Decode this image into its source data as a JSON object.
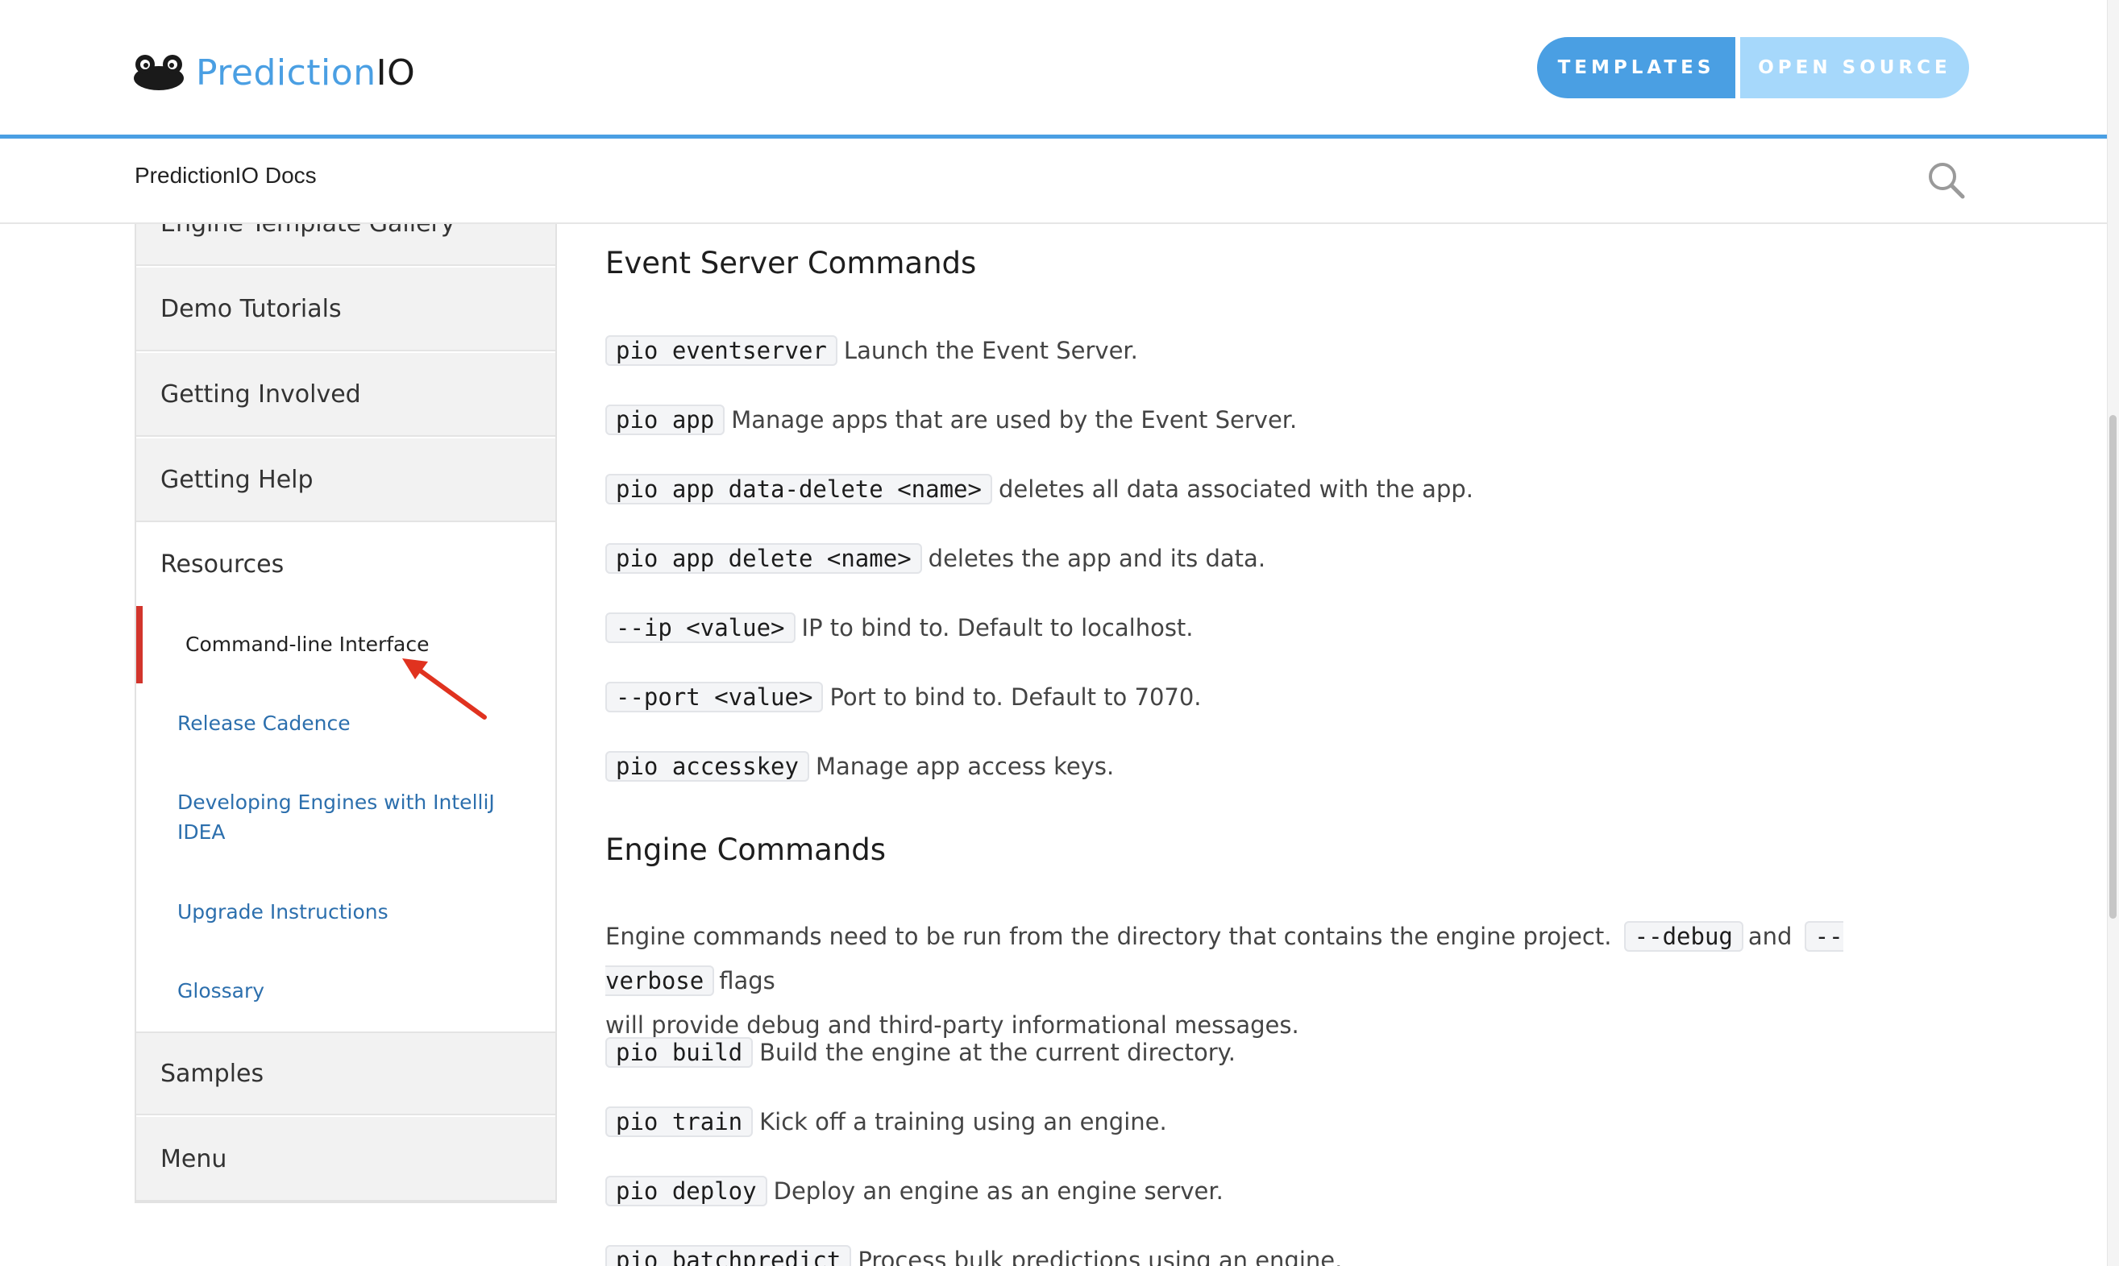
{
  "header": {
    "logo_text_part1": "Prediction",
    "logo_text_part2": "IO",
    "buttons": {
      "templates": "TEMPLATES",
      "open_source": "OPEN SOURCE"
    },
    "colors": {
      "accent": "#4a9fe3",
      "secondary": "#a6d8fb"
    }
  },
  "subheader": {
    "title": "PredictionIO Docs",
    "search_icon": "search-icon"
  },
  "sidebar": {
    "items_top": [
      {
        "label": "Engine Template Gallery"
      },
      {
        "label": "Demo Tutorials"
      },
      {
        "label": "Getting Involved"
      },
      {
        "label": "Getting Help"
      }
    ],
    "resources": {
      "label": "Resources",
      "children": [
        {
          "label": "Command-line Interface",
          "active": true
        },
        {
          "label": "Release Cadence"
        },
        {
          "label": "Developing Engines with IntelliJ IDEA"
        },
        {
          "label": "Upgrade Instructions"
        },
        {
          "label": "Glossary"
        }
      ]
    },
    "items_bottom": [
      {
        "label": "Samples"
      },
      {
        "label": "Menu"
      }
    ],
    "active_color": "#d2352c"
  },
  "content": {
    "event_server": {
      "heading": "Event Server Commands",
      "commands": [
        {
          "code": "pio eventserver",
          "desc": "Launch the Event Server."
        },
        {
          "code": "pio app",
          "desc": "Manage apps that are used by the Event Server."
        },
        {
          "code": "pio app data-delete <name>",
          "desc": "deletes all data associated with the app."
        },
        {
          "code": "pio app delete <name>",
          "desc": "deletes the app and its data."
        },
        {
          "code": "--ip <value>",
          "desc": "IP to bind to. Default to localhost."
        },
        {
          "code": "--port <value>",
          "desc": "Port to bind to. Default to 7070."
        },
        {
          "code": "pio accesskey",
          "desc": "Manage app access keys."
        }
      ]
    },
    "engine": {
      "heading": "Engine Commands",
      "intro_part1": "Engine commands need to be run from the directory that contains the engine project.",
      "intro_code1": "--debug",
      "intro_part2": "and",
      "intro_code2": "--verbose",
      "intro_part3": "flags",
      "intro_line2": "will provide debug and third-party informational messages.",
      "commands": [
        {
          "code": "pio build",
          "desc": "Build the engine at the current directory."
        },
        {
          "code": "pio train",
          "desc": "Kick off a training using an engine."
        },
        {
          "code": "pio deploy",
          "desc": "Deploy an engine as an engine server."
        },
        {
          "code": "pio batchpredict",
          "desc": "Process bulk predictions using an engine."
        }
      ]
    }
  }
}
